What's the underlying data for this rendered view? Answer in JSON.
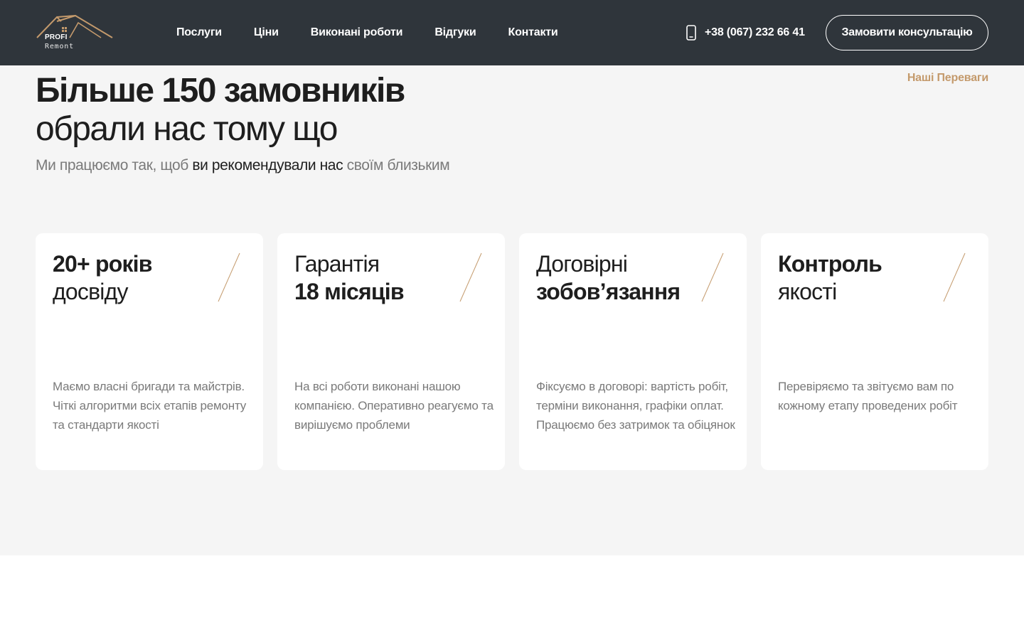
{
  "header": {
    "logo": {
      "line1": "PROFI",
      "line2": "Remont",
      "icon": "house-roof-logo"
    },
    "nav": [
      "Послуги",
      "Ціни",
      "Виконані роботи",
      "Відгуки",
      "Контакти"
    ],
    "phone": {
      "icon": "smartphone-icon",
      "number": "+38 (067) 232 66 41"
    },
    "cta_label": "Замовити консультацію"
  },
  "section": {
    "eyebrow": "Наші Переваги",
    "heading_line1": "Більше 150 замовників",
    "heading_line2": "обрали нас тому що",
    "lead": {
      "before": "Ми працюємо так, щоб ",
      "emphasis": "ви рекомендували нас",
      "after": " своїм близьким"
    }
  },
  "cards": [
    {
      "line1": "20+ років",
      "line2": "досвіду",
      "text": "Маємо власні бригади та майстрів. Чіткі алгоритми всіх етапів ремонту та стандарти якості"
    },
    {
      "line1": "Гарантія",
      "line2": "18 місяців",
      "text": "На всі роботи виконані нашою компанією. Оперативно реагуємо та вирішуємо проблеми"
    },
    {
      "line1": "Договірні",
      "line2": "зобов’язання",
      "text": "Фіксуємо в договорі: вартість робіт, терміни виконання, графіки оплат. Працюємо без затримок та обіцянок"
    },
    {
      "line1": "Контроль",
      "line2": "якості",
      "text": "Перевіряємо та звітуємо вам по кожному етапу проведених робіт"
    }
  ],
  "colors": {
    "header_bg": "#2f353b",
    "accent_gold": "#c49a6c",
    "section_bg": "#f5f5f5",
    "card_bg": "#ffffff",
    "muted_text": "#7a7a7a"
  }
}
